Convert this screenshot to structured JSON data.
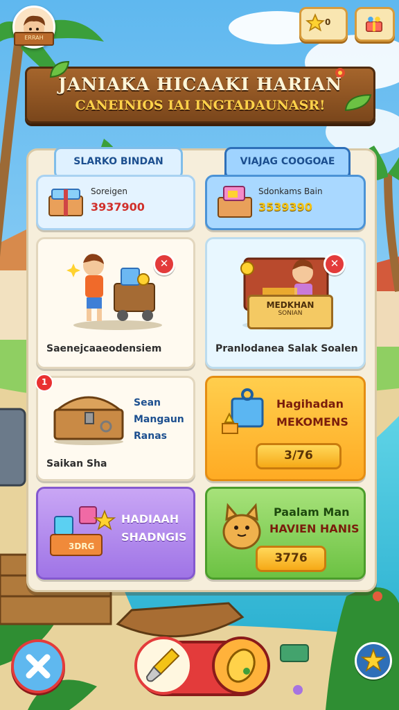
{
  "header": {
    "avatar_tag": "ERRAH",
    "stars_value": "0",
    "stars_icon": "star-icon",
    "gift_icon": "gift-icon"
  },
  "banner": {
    "title": "JANIAKA HICAAKI HARIAN",
    "subtitle": "CANEINIOS IAI INGTADAUNASR!"
  },
  "tabs": [
    {
      "label": "SLARKO BINDAN"
    },
    {
      "label": "VIAJAG COOGOAE"
    }
  ],
  "top_cards": [
    {
      "label": "Soreigen",
      "value": "3937900"
    },
    {
      "label": "Sdonkams Bain",
      "value": "3539390"
    }
  ],
  "mid_cards": [
    {
      "label": "Saenejcaaeodensiem"
    },
    {
      "sign_text": "MEDKHAN",
      "sign_sub": "SONIAN",
      "label": "Pranlodanea Salak Soalen"
    }
  ],
  "chest_card": {
    "badge": "1",
    "title_lines": [
      "Sean",
      "Mangaun",
      "Ranas"
    ],
    "footer": "Saikan Sha"
  },
  "orange_card": {
    "line1": "Hagihadan",
    "line2": "MEKOMENS",
    "value": "3/76"
  },
  "purple_card": {
    "line1": "HADIAAH",
    "line2": "SHADNGIS",
    "box_label": "3DRG"
  },
  "green_card": {
    "line1": "Paalam Man",
    "line2": "HAVIEN HANIS",
    "value": "3776"
  },
  "colors": {
    "sky": "#7cc7f2",
    "wood": "#8a5222",
    "banner_yellow": "#ffd24a",
    "accent_blue": "#2e6fb8",
    "accent_red": "#e33b3b"
  }
}
